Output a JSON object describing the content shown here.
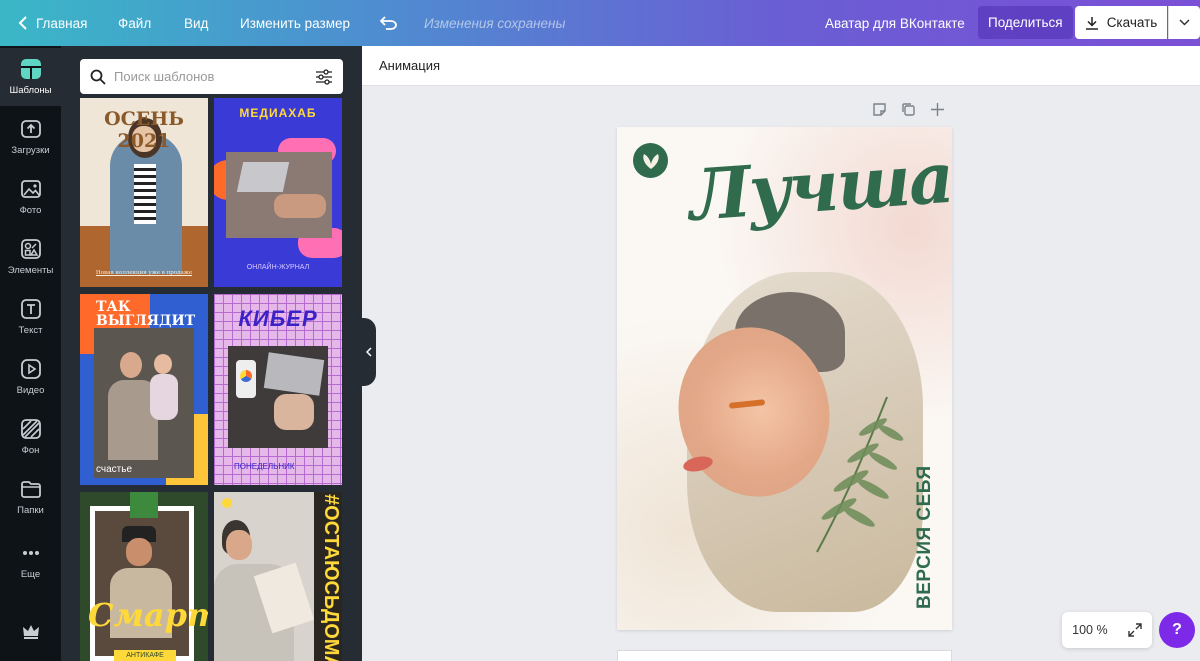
{
  "topbar": {
    "home": "Главная",
    "file": "Файл",
    "view": "Вид",
    "resize": "Изменить размер",
    "saved": "Изменения сохранены",
    "design_title": "Аватар для ВКонтакте",
    "share": "Поделиться",
    "download": "Скачать"
  },
  "rail": [
    {
      "label": "Шаблоны",
      "icon": "templates-icon"
    },
    {
      "label": "Загрузки",
      "icon": "upload-icon"
    },
    {
      "label": "Фото",
      "icon": "photo-icon"
    },
    {
      "label": "Элементы",
      "icon": "elements-icon"
    },
    {
      "label": "Текст",
      "icon": "text-icon"
    },
    {
      "label": "Видео",
      "icon": "video-icon"
    },
    {
      "label": "Фон",
      "icon": "background-icon"
    },
    {
      "label": "Папки",
      "icon": "folder-icon"
    },
    {
      "label": "Еще",
      "icon": "more-icon"
    }
  ],
  "search": {
    "placeholder": "Поиск шаблонов"
  },
  "templates": [
    {
      "title": "ОСЕНЬ 2021",
      "caption": "Новая коллекция уже в продаже"
    },
    {
      "title": "МЕДИАХАБ",
      "caption": "ОНЛАЙН-ЖУРНАЛ"
    },
    {
      "title": "ТАК\nВЫГЛЯДИТ",
      "caption": "счастье"
    },
    {
      "title": "КИБЕР",
      "caption": "ПОНЕДЕЛЬНИК"
    },
    {
      "title": "Смарт",
      "caption": "АНТИКАФЕ"
    },
    {
      "title": "#ОСТАЮСЬДОМА",
      "caption": ""
    }
  ],
  "subbar": {
    "animation": "Анимация"
  },
  "design": {
    "headline": "Лучшая",
    "vertical": "ВЕРСИЯ СЕБЯ"
  },
  "zoom": {
    "level": "100 %"
  },
  "help": {
    "label": "?"
  },
  "colors": {
    "accent": "#7d2ae8",
    "panel": "#252c33",
    "rail": "#0e1318",
    "headline": "#2f6b4c"
  }
}
